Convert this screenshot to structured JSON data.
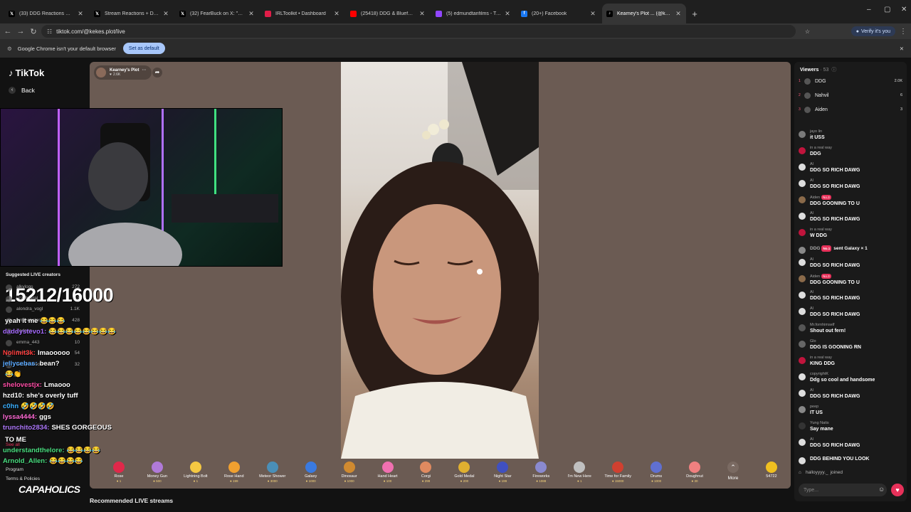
{
  "browser": {
    "tabs": [
      {
        "title": "(33) DDG Reactions Communit",
        "icon": "x-icon",
        "color": "#000000"
      },
      {
        "title": "Stream Reactions + Drama | Co",
        "icon": "x-icon",
        "color": "#000000"
      },
      {
        "title": "(32) FearBuck on X: \"Marlon wa",
        "icon": "x-icon",
        "color": "#000000"
      },
      {
        "title": "IRLToolkit • Dashboard",
        "icon": "toolkit-icon",
        "color": "#e11d48"
      },
      {
        "title": "(25418) DDG & Blueface - Hab",
        "icon": "youtube-icon",
        "color": "#ff0000"
      },
      {
        "title": "(5) edmundtanfilms - Twitch",
        "icon": "twitch-icon",
        "color": "#9146ff"
      },
      {
        "title": "(20+) Facebook",
        "icon": "facebook-icon",
        "color": "#1877f2"
      },
      {
        "title": "Kearney's Plot ... (@kekes",
        "icon": "tiktok-icon",
        "color": "#000000",
        "active": true
      }
    ],
    "new_tab": "+",
    "window_controls": [
      "–",
      "▢",
      "✕"
    ],
    "url": "tiktok.com/@kekes.plot/live",
    "verify_label": "Verify it's you",
    "infobar_text": "Google Chrome isn't your default browser",
    "set_default_label": "Set as default",
    "infobar_close": "✕"
  },
  "tiktok": {
    "logo": "TikTok",
    "back_label": "Back",
    "host": {
      "name": "Kearney's Plot",
      "likes": "2.6K"
    },
    "recommended_label": "Recommended LIVE streams",
    "suggested_label": "Suggested LIVE creators",
    "suggested": [
      {
        "name": "alkvlogs",
        "count": "272"
      },
      {
        "name": "lizzyhpetal",
        "count": "13"
      },
      {
        "name": "alondra_vogl",
        "count": "1.1K"
      },
      {
        "name": "iamleekstar",
        "count": "428"
      },
      {
        "name": "Zadaen",
        "count": "98"
      },
      {
        "name": "emma_443",
        "count": "10"
      },
      {
        "name": "Bowcht",
        "count": "54"
      },
      {
        "name": "dee.pinkkkss",
        "count": "32"
      }
    ],
    "see_all": "See all",
    "program": "Program",
    "terms": "Terms & Policies",
    "gifts": [
      {
        "name": "Rose",
        "price": "1",
        "color": "#e0284a"
      },
      {
        "name": "Money Gun",
        "price": "500",
        "color": "#b07ad8"
      },
      {
        "name": "Lightning Bolt",
        "price": "1",
        "color": "#f5c842"
      },
      {
        "name": "Rose Hand",
        "price": "199",
        "color": "#f0a030"
      },
      {
        "name": "Meteor Shower",
        "price": "3000",
        "color": "#4a8fb8"
      },
      {
        "name": "Galaxy",
        "price": "1000",
        "color": "#3a7ae0"
      },
      {
        "name": "Dinosaur",
        "price": "1000",
        "color": "#d08a30"
      },
      {
        "name": "Hand Heart",
        "price": "100",
        "color": "#f070b0"
      },
      {
        "name": "Corgi",
        "price": "299",
        "color": "#e08a60"
      },
      {
        "name": "Gold Medal",
        "price": "200",
        "color": "#e0b030"
      },
      {
        "name": "Night Star",
        "price": "199",
        "color": "#4050c0"
      },
      {
        "name": "Fireworks",
        "price": "1088",
        "color": "#8a8ad0"
      },
      {
        "name": "I'm New Here",
        "price": "1",
        "color": "#c0c0c0"
      },
      {
        "name": "Time for Family",
        "price": "15000",
        "color": "#d04030"
      },
      {
        "name": "Drums",
        "price": "1000",
        "color": "#6070d0"
      },
      {
        "name": "Doughnut",
        "price": "30",
        "color": "#f08080"
      }
    ],
    "more_label": "More",
    "coins": "54722"
  },
  "overlay": {
    "counter": "15212/16000",
    "brand": "CAPAHOLICS",
    "lines": [
      {
        "user": "",
        "text": "yeah it me 😂😂😂",
        "color": "#ff4d6d"
      },
      {
        "user": "daddystevo1:",
        "text": "😂😂😂😂😂😂😂😂",
        "color": "#a66bff"
      },
      {
        "user": "Nolimit3k:",
        "text": "lmaooooo",
        "color": "#ff3b3b"
      },
      {
        "user": "jellycebas:",
        "text": "bean?",
        "color": "#5aa9ff"
      },
      {
        "user": "",
        "text": "😂👏",
        "color": "#ffffff"
      },
      {
        "user": "shelovestjx:",
        "text": "Lmaooo",
        "color": "#ff4da6"
      },
      {
        "user": "hzd10:",
        "text": "she's overly tuff",
        "color": "#ffffff"
      },
      {
        "user": "c0hn",
        "text": "🤣🤣🤣🤣",
        "color": "#3bb0ff"
      },
      {
        "user": "lyssa4444:",
        "text": "ggs",
        "color": "#ff6ad5"
      },
      {
        "user": "trunchito2834:",
        "text": "SHES GORGEOUS",
        "color": "#b07aff"
      },
      {
        "user": "",
        "text": "TO ME",
        "color": "#ffffff"
      },
      {
        "user": "understandthelore:",
        "text": "😂😂😂😂",
        "color": "#4ade80"
      },
      {
        "user": "Arnold_Allen:",
        "text": "😂😂😂😂",
        "color": "#4ade80"
      }
    ]
  },
  "panel": {
    "viewers_label": "Viewers",
    "viewers_count": "53",
    "top_viewers": [
      {
        "rank": "1",
        "name": "DDG",
        "score": "2.0K"
      },
      {
        "rank": "2",
        "name": "Nahvil",
        "score": "6"
      },
      {
        "rank": "3",
        "name": "Aiden",
        "score": "3"
      }
    ],
    "chat": [
      {
        "user": "jayo lin",
        "text": "it USS",
        "avatar": "#7a7a7a"
      },
      {
        "user": "in a real way",
        "text": "DDG",
        "avatar": "#c0143c"
      },
      {
        "user": "Al",
        "text": "DDG SO RICH DAWG",
        "avatar": "#dddddd"
      },
      {
        "user": "Al",
        "text": "DDG SO RICH DAWG",
        "avatar": "#dddddd"
      },
      {
        "user": "Aiden",
        "badge": "No.3",
        "text": "DDG GOONING TO U",
        "avatar": "#8a6a4a"
      },
      {
        "user": "Al",
        "text": "DDG SO RICH DAWG",
        "avatar": "#dddddd"
      },
      {
        "user": "in a real way",
        "text": "W DDG",
        "avatar": "#c0143c"
      },
      {
        "user": "DDG",
        "badge": "No.1",
        "text": "sent Galaxy × 1",
        "avatar": "#888888",
        "gift": true
      },
      {
        "user": "Al",
        "text": "DDG SO RICH DAWG",
        "avatar": "#dddddd"
      },
      {
        "user": "Aiden",
        "badge": "No.3",
        "text": "DDG GOONING TO U",
        "avatar": "#8a6a4a"
      },
      {
        "user": "Al",
        "text": "DDG SO RICH DAWG",
        "avatar": "#dddddd"
      },
      {
        "user": "Al",
        "text": "DDG SO RICH DAWG",
        "avatar": "#dddddd"
      },
      {
        "user": "Mr.fornhimself",
        "text": "Shout out fern!",
        "avatar": "#555555"
      },
      {
        "user": "Glo",
        "text": "DDG IS GOONING RN",
        "avatar": "#666666"
      },
      {
        "user": "in a real way",
        "text": "KING DDG",
        "avatar": "#c0143c"
      },
      {
        "user": "copyrightK",
        "text": "Ddg so cool and handsome",
        "avatar": "#dddddd"
      },
      {
        "user": "Al",
        "text": "DDG SO RICH DAWG",
        "avatar": "#dddddd"
      },
      {
        "user": "peep",
        "text": "IT US",
        "avatar": "#888888"
      },
      {
        "user": "Yung Natis",
        "text": "Say mane",
        "avatar": "#333333"
      },
      {
        "user": "Al",
        "text": "DDG SO RICH DAWG",
        "avatar": "#dddddd"
      },
      {
        "user": "",
        "text": "DDG BEHIND YOU LOOK",
        "avatar": "#dddddd"
      }
    ],
    "join_notice_user": "halloyyyy._",
    "join_notice_text": "joined",
    "input_placeholder": "Type..."
  }
}
